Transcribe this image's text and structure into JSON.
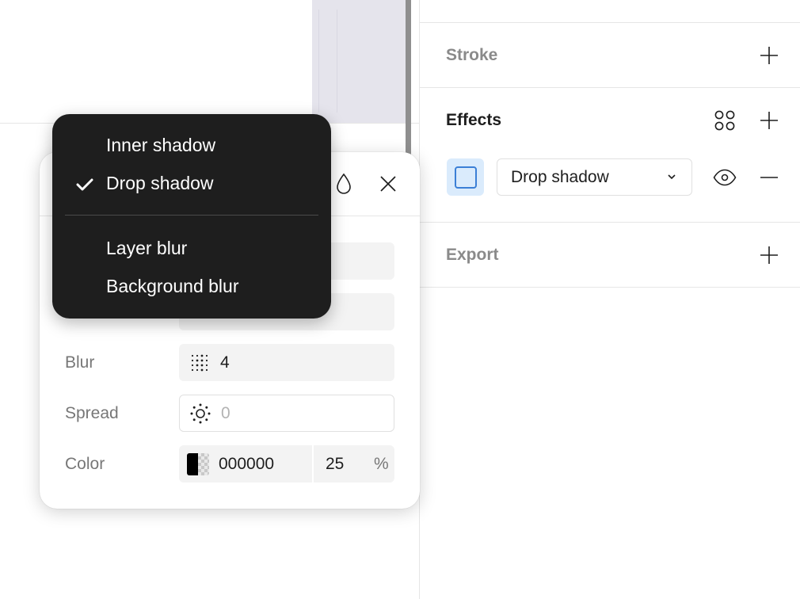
{
  "panel": {
    "stroke": {
      "title": "Stroke"
    },
    "effects": {
      "title": "Effects",
      "effect_type": "Drop shadow"
    },
    "export": {
      "title": "Export"
    }
  },
  "popover": {
    "blur": {
      "label": "Blur",
      "value": "4"
    },
    "spread": {
      "label": "Spread",
      "value": "0"
    },
    "color": {
      "label": "Color",
      "hex": "000000",
      "opacity": "25",
      "unit": "%"
    }
  },
  "menu": {
    "items": [
      {
        "label": "Inner shadow",
        "checked": false
      },
      {
        "label": "Drop shadow",
        "checked": true
      },
      {
        "label": "Layer blur",
        "checked": false
      },
      {
        "label": "Background blur",
        "checked": false
      }
    ]
  },
  "colors": {
    "accent": "#3b7fd6",
    "swatch_bg": "#daebfc",
    "menu_bg": "#1e1e1e"
  }
}
